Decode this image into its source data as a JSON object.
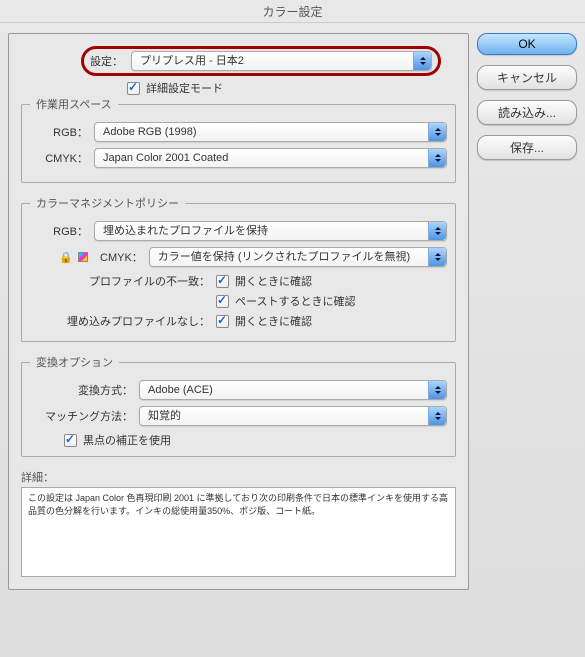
{
  "titlebar": "カラー設定",
  "buttons": {
    "ok": "OK",
    "cancel": "キャンセル",
    "load": "読み込み...",
    "save": "保存..."
  },
  "settings": {
    "label": "設定：",
    "value": "プリプレス用 - 日本2",
    "advanced_label": "詳細設定モード"
  },
  "workspace": {
    "legend": "作業用スペース",
    "rgb_label": "RGB：",
    "rgb_value": "Adobe RGB (1998)",
    "cmyk_label": "CMYK：",
    "cmyk_value": "Japan Color 2001 Coated"
  },
  "policy": {
    "legend": "カラーマネジメントポリシー",
    "rgb_label": "RGB：",
    "rgb_value": "埋め込まれたプロファイルを保持",
    "cmyk_label": "CMYK：",
    "cmyk_value": "カラー値を保持 (リンクされたプロファイルを無視)",
    "mismatch_label": "プロファイルの不一致：",
    "ask_open": "開くときに確認",
    "ask_paste": "ペーストするときに確認",
    "missing_label": "埋め込みプロファイルなし："
  },
  "conversion": {
    "legend": "変換オプション",
    "engine_label": "変換方式：",
    "engine_value": "Adobe (ACE)",
    "intent_label": "マッチング方法：",
    "intent_value": "知覚的",
    "bpc_label": "黒点の補正を使用"
  },
  "detail": {
    "label": "詳細：",
    "text": "この設定は Japan Color 色再現印刷 2001 に準拠しており次の印刷条件で日本の標準インキを使用する高品質の色分解を行います。インキの総使用量350%、ポジ版、コート紙。"
  }
}
